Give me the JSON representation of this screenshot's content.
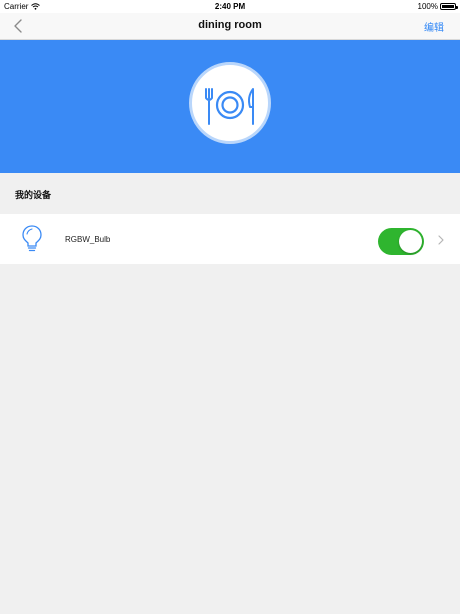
{
  "status_bar": {
    "carrier": "Carrier",
    "time": "2:40 PM",
    "battery": "100%"
  },
  "nav": {
    "title": "dining room",
    "edit_label": "编辑",
    "back_icon": "chevron-left-icon",
    "accent_color": "#2f86f6"
  },
  "banner": {
    "color": "#3a8af5",
    "icon": "dining-plate-icon"
  },
  "section": {
    "title": "我的设备"
  },
  "devices": [
    {
      "name": "RGBW_Bulb",
      "icon": "light-bulb-icon",
      "power_on": true,
      "toggle_color": "#2fb52f"
    }
  ]
}
